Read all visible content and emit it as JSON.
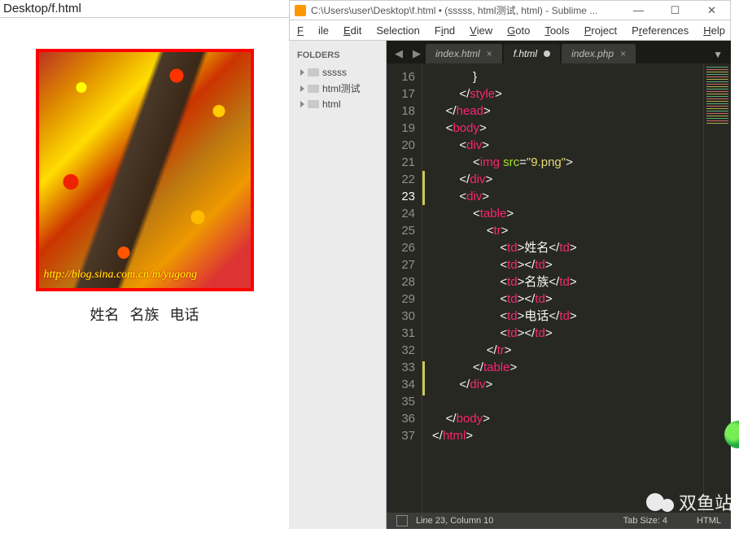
{
  "browser": {
    "address": "Desktop/f.html",
    "watermark": "http://blog.sina.com.cn/m/yugong",
    "table": {
      "c1": "姓名",
      "c2": "名族",
      "c3": "电话"
    }
  },
  "sublime": {
    "title": "C:\\Users\\user\\Desktop\\f.html • (sssss, html测试, html) - Sublime ...",
    "menu": {
      "file": "File",
      "edit": "Edit",
      "sel": "Selection",
      "find": "Find",
      "view": "View",
      "goto": "Goto",
      "tools": "Tools",
      "project": "Project",
      "pref": "Preferences",
      "help": "Help"
    },
    "sidebar": {
      "header": "FOLDERS",
      "items": [
        "sssss",
        "html测试",
        "html"
      ]
    },
    "tabs": {
      "t1": "index.html",
      "t2": "f.html",
      "t3": "index.php"
    },
    "lines": [
      "16",
      "17",
      "18",
      "19",
      "20",
      "21",
      "22",
      "23",
      "24",
      "25",
      "26",
      "27",
      "28",
      "29",
      "30",
      "31",
      "32",
      "33",
      "34",
      "35",
      "36",
      "37"
    ],
    "current_line": "23",
    "code": {
      "l16": "}",
      "l21_attr": "src",
      "l21_val": "\"9.png\"",
      "l26_txt": "姓名",
      "l28_txt": "名族",
      "l30_txt": "电话"
    },
    "tags": {
      "style": "style",
      "head": "head",
      "body": "body",
      "div": "div",
      "img": "img",
      "table": "table",
      "tr": "tr",
      "td": "td",
      "html": "html"
    },
    "status": {
      "pos": "Line 23, Column 10",
      "tab": "Tab Size: 4",
      "lang": "HTML"
    }
  },
  "watermark_text": "双鱼站"
}
